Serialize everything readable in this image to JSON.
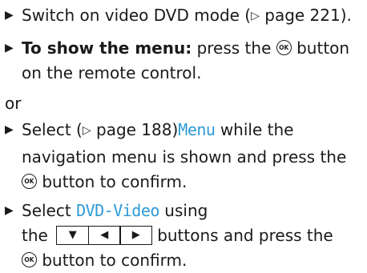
{
  "steps": {
    "s1": {
      "bullet": "▶",
      "text_before": "Switch on video DVD mode (",
      "pageref_icon": "▷",
      "pageref": " page 221)."
    },
    "s2": {
      "bullet": "▶",
      "bold": "To show the menu:",
      "text_before": " press the ",
      "ok_label": "OK",
      "text_after": " button",
      "line2": "on the remote control."
    },
    "or": "or",
    "s3": {
      "bullet": "▶",
      "text_before": "Select (",
      "pageref_icon": "▷",
      "pageref": " page 188)",
      "ui_label": "Menu",
      "text_after": " while the",
      "line2": "navigation menu is shown and press the",
      "ok_label": "OK",
      "line3": " button to confirm."
    },
    "s4": {
      "bullet": "▶",
      "text_before": "Select ",
      "ui_label": "DVD-Video",
      "text_after": " using",
      "line2_before": "the",
      "buttons": [
        "▼",
        "◀",
        "▶"
      ],
      "line2_after": "buttons and press the",
      "ok_label": "OK",
      "line3": " button to confirm."
    }
  }
}
